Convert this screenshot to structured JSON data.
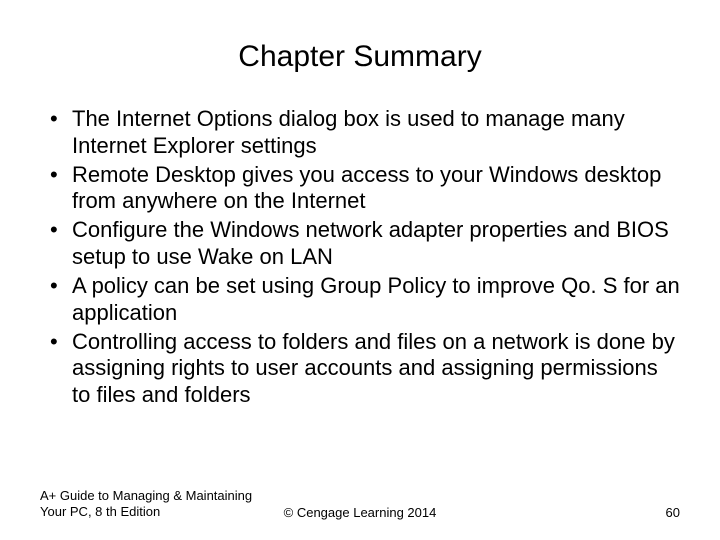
{
  "title": "Chapter Summary",
  "bullets": [
    "The Internet Options dialog box is used to manage many Internet Explorer settings",
    "Remote Desktop gives you access to your Windows desktop from anywhere on the Internet",
    "Configure the Windows network adapter properties and BIOS setup to use Wake on LAN",
    "A policy can be set using Group Policy to improve Qo. S for an application",
    "Controlling access to folders and files on a network is done by assigning rights to user accounts and assigning permissions to files and folders"
  ],
  "footer": {
    "left": "A+ Guide to Managing & Maintaining Your PC, 8 th Edition",
    "center": "©  Cengage Learning 2014",
    "right": "60"
  }
}
